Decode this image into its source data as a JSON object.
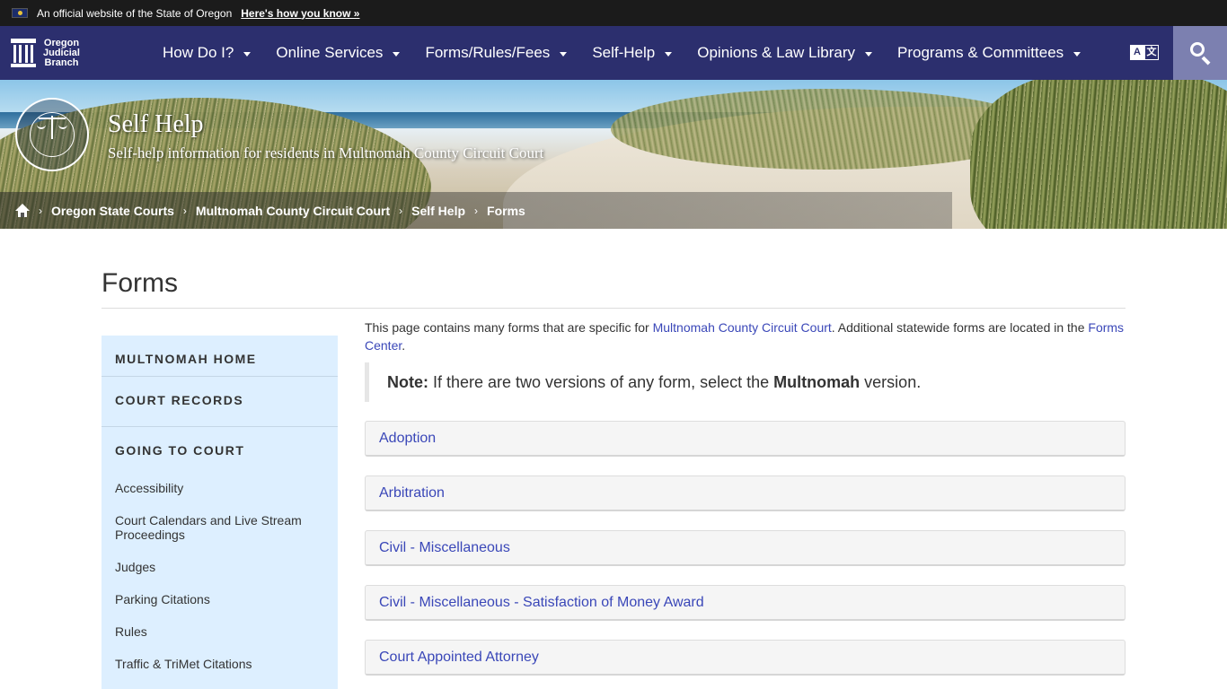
{
  "official_banner": {
    "text": "An official website of the State of Oregon",
    "link": "Here's how you know »"
  },
  "navbar": {
    "logo_lines": [
      "Oregon",
      "Judicial",
      "Branch"
    ],
    "items": [
      {
        "label": "How Do I?"
      },
      {
        "label": "Online Services"
      },
      {
        "label": "Forms/Rules/Fees"
      },
      {
        "label": "Self-Help"
      },
      {
        "label": "Opinions & Law Library"
      },
      {
        "label": "Programs & Committees"
      }
    ],
    "translate_a": "A",
    "translate_zh": "文",
    "search_icon": "search-icon"
  },
  "hero": {
    "title": "Self Help",
    "subtitle": "Self-help information for residents in Multnomah County Circuit Court",
    "seal_icon": "judicial-department-seal"
  },
  "breadcrumb": {
    "home_icon": "home-icon",
    "separator": "›",
    "items": [
      "Oregon State Courts",
      "Multnomah County Circuit Court",
      "Self Help",
      "Forms"
    ]
  },
  "page": {
    "title": "Forms"
  },
  "sidebar": {
    "headings": [
      "MULTNOMAH HOME",
      "COURT RECORDS",
      "GOING TO COURT"
    ],
    "links": [
      "Accessibility",
      "Court Calendars and Live Stream Proceedings",
      "Judges",
      "Parking Citations",
      "Rules",
      "Traffic & TriMet Citations"
    ]
  },
  "intro": {
    "text_before": "This page contains many forms that are specific for ",
    "link1": "Multnomah County Circuit Court",
    "text_middle": ". Additional statewide forms are located in the ",
    "link2": "Forms Center",
    "text_after": "."
  },
  "note": {
    "label": "Note:",
    "text_before": " If there are two versions of any form, select the ",
    "bold": "Multnomah",
    "text_after": " version."
  },
  "accordion": [
    "Adoption",
    "Arbitration",
    "Civil - Miscellaneous",
    "Civil - Miscellaneous - Satisfaction of Money Award",
    "Court Appointed Attorney"
  ],
  "colors": {
    "nav_bg": "#2c2f6e",
    "link": "#3a47b8",
    "sidebar_bg": "#ddefff",
    "search_bg": "#7c80b0"
  }
}
